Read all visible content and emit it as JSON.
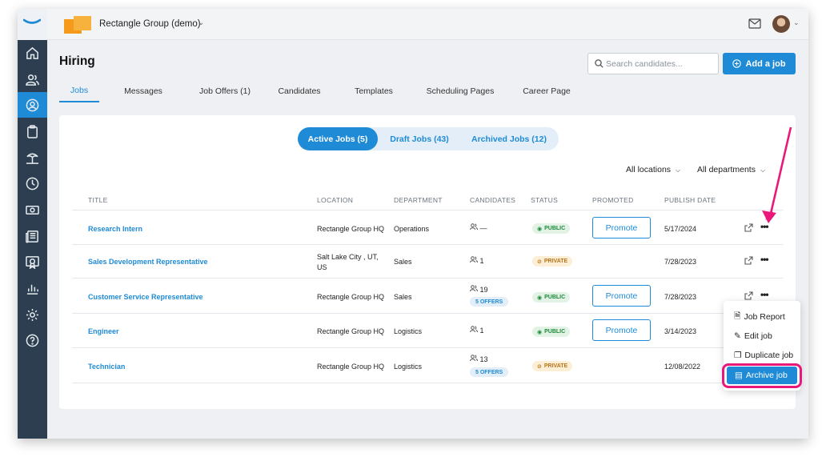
{
  "topbar": {
    "org_name": "Rectangle Group (demo)",
    "icons": [
      "workable-logo-icon",
      "mail-icon",
      "avatar",
      "chevron-down-icon"
    ]
  },
  "sidebar": {
    "items": [
      {
        "icon": "home-icon",
        "active": false
      },
      {
        "icon": "people-icon",
        "active": false
      },
      {
        "icon": "user-search-icon",
        "active": true
      },
      {
        "icon": "clipboard-icon",
        "active": false
      },
      {
        "icon": "beach-icon",
        "active": false
      },
      {
        "icon": "clock-icon",
        "active": false
      },
      {
        "icon": "money-icon",
        "active": false
      },
      {
        "icon": "news-icon",
        "active": false
      },
      {
        "icon": "certificate-icon",
        "active": false
      },
      {
        "icon": "bar-chart-icon",
        "active": false
      },
      {
        "icon": "gear-icon",
        "active": false
      },
      {
        "icon": "help-icon",
        "active": false
      }
    ]
  },
  "header": {
    "title": "Hiring",
    "search_placeholder": "Search candidates...",
    "add_job": "Add a job"
  },
  "tabs": [
    {
      "label": "Jobs",
      "active": true
    },
    {
      "label": "Messages"
    },
    {
      "label": "Job Offers (1)"
    },
    {
      "label": "Candidates"
    },
    {
      "label": "Templates"
    },
    {
      "label": "Scheduling Pages"
    },
    {
      "label": "Career Page"
    }
  ],
  "segments": [
    {
      "label": "Active Jobs (5)",
      "active": true
    },
    {
      "label": "Draft Jobs (43)"
    },
    {
      "label": "Archived Jobs (12)"
    }
  ],
  "filters": {
    "locations": "All locations",
    "departments": "All departments"
  },
  "table": {
    "columns": [
      "TITLE",
      "LOCATION",
      "DEPARTMENT",
      "CANDIDATES",
      "STATUS",
      "PROMOTED",
      "PUBLISH DATE"
    ],
    "rows": [
      {
        "title": "Research Intern",
        "location": "Rectangle Group HQ",
        "department": "Operations",
        "candidates": "—",
        "offers": "",
        "status": "PUBLIC",
        "promote": "Promote",
        "date": "5/17/2024"
      },
      {
        "title": "Sales Development Representative",
        "location": "Salt Lake City , UT, US",
        "department": "Sales",
        "candidates": "1",
        "offers": "",
        "status": "PRIVATE",
        "promote": "",
        "date": "7/28/2023"
      },
      {
        "title": "Customer Service Representative",
        "location": "Rectangle Group HQ",
        "department": "Sales",
        "candidates": "19",
        "offers": "5 OFFERS",
        "status": "PUBLIC",
        "promote": "Promote",
        "date": "7/28/2023"
      },
      {
        "title": "Engineer",
        "location": "Rectangle Group HQ",
        "department": "Logistics",
        "candidates": "1",
        "offers": "",
        "status": "PUBLIC",
        "promote": "Promote",
        "date": "3/14/2023"
      },
      {
        "title": "Technician",
        "location": "Rectangle Group HQ",
        "department": "Logistics",
        "candidates": "13",
        "offers": "5 OFFERS",
        "status": "PRIVATE",
        "promote": "",
        "date": "12/08/2022"
      }
    ]
  },
  "menu": {
    "items": [
      {
        "label": "Job Report",
        "icon": "document-icon"
      },
      {
        "label": "Edit job",
        "icon": "pencil-icon"
      },
      {
        "label": "Duplicate job",
        "icon": "copy-icon"
      },
      {
        "label": "Archive job",
        "icon": "archive-icon",
        "highlighted": true
      }
    ]
  },
  "colors": {
    "accent": "#1f8bd6",
    "sidebar": "#2c3e50",
    "highlight_ring": "#e8197a",
    "public": "#1f8a3c",
    "private": "#b7741b"
  }
}
